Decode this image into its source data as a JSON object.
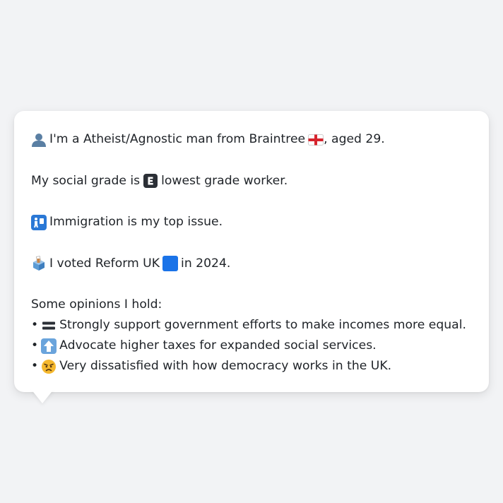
{
  "persona_card": {
    "line1": {
      "prefix": "I'm a Atheist/Agnostic man from Braintree",
      "suffix": ", aged 29.",
      "icon": "person-silhouette-icon",
      "flag_icon": "england-flag-icon"
    },
    "line2": {
      "prefix": "My social grade is",
      "suffix": "lowest grade worker.",
      "icon": "letter-e-icon"
    },
    "line3": {
      "text": "Immigration is my top issue.",
      "icon": "passport-control-icon"
    },
    "line4": {
      "prefix": "I voted Reform UK",
      "suffix": "in 2024.",
      "icon": "ballot-box-icon",
      "party_icon": "blue-square-icon"
    },
    "opinions_heading": "Some opinions I hold:",
    "opinions": [
      {
        "bullet": "•",
        "text": "Strongly support government efforts to make incomes more equal.",
        "icon": "equals-sign-icon"
      },
      {
        "bullet": "•",
        "text": "Advocate higher taxes for expanded social services.",
        "icon": "up-arrow-icon"
      },
      {
        "bullet": "•",
        "text": "Very dissatisfied with how democracy works in the UK.",
        "icon": "angry-face-icon"
      }
    ],
    "colors": {
      "text": "#1f2328",
      "card_background": "#ffffff",
      "page_background": "#f2f3f5",
      "party_blue": "#1a73e8",
      "flag_red": "#d6242d"
    }
  }
}
